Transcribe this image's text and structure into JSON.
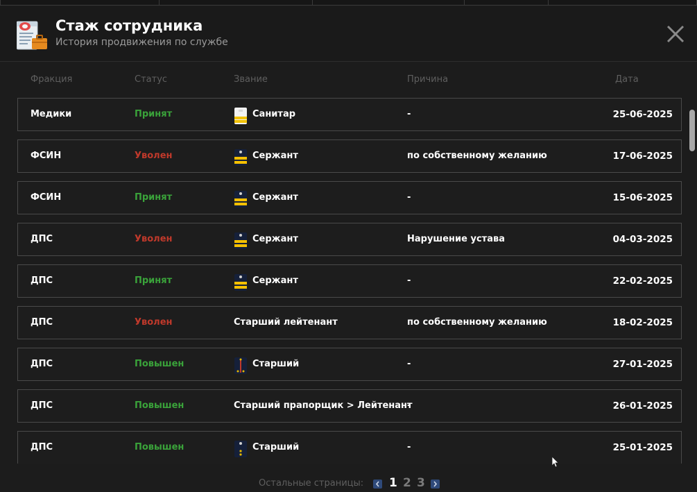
{
  "dialog": {
    "title": "Стаж сотрудника",
    "subtitle": "История продвижения по службе"
  },
  "columns": {
    "faction": "Фракция",
    "status": "Статус",
    "rank": "Звание",
    "reason": "Причина",
    "date": "Дата"
  },
  "rows": [
    {
      "faction": "Медики",
      "status": "Принят",
      "status_type": "green",
      "rank_icon": "medic-rank-icon",
      "rank": "Санитар",
      "reason": "-",
      "date": "25-06-2025"
    },
    {
      "faction": "ФСИН",
      "status": "Уволен",
      "status_type": "red",
      "rank_icon": "sergeant-rank-icon",
      "rank": "Сержант",
      "reason": "по собственному желанию",
      "date": "17-06-2025"
    },
    {
      "faction": "ФСИН",
      "status": "Принят",
      "status_type": "green",
      "rank_icon": "sergeant-rank-icon",
      "rank": "Сержант",
      "reason": "-",
      "date": "15-06-2025"
    },
    {
      "faction": "ДПС",
      "status": "Уволен",
      "status_type": "red",
      "rank_icon": "sergeant-rank-icon",
      "rank": "Сержант",
      "reason": "Нарушение устава",
      "date": "04-03-2025"
    },
    {
      "faction": "ДПС",
      "status": "Принят",
      "status_type": "green",
      "rank_icon": "sergeant-rank-icon",
      "rank": "Сержант",
      "reason": "-",
      "date": "22-02-2025"
    },
    {
      "faction": "ДПС",
      "status": "Уволен",
      "status_type": "red",
      "rank_icon": "",
      "rank": "Старший лейтенант",
      "reason": "по собственному желанию",
      "date": "18-02-2025"
    },
    {
      "faction": "ДПС",
      "status": "Повышен",
      "status_type": "green",
      "rank_icon": "officer-rank-icon",
      "rank": "Старший",
      "reason": "-",
      "date": "27-01-2025"
    },
    {
      "faction": "ДПС",
      "status": "Повышен",
      "status_type": "green",
      "rank_icon": "",
      "rank": "Старший прапорщик > Лейтенант",
      "reason": "-",
      "date": "26-01-2025"
    },
    {
      "faction": "ДПС",
      "status": "Повышен",
      "status_type": "green",
      "rank_icon": "ensign-rank-icon",
      "rank": "Старший",
      "reason": "-",
      "date": "25-01-2025"
    }
  ],
  "pagination": {
    "label": "Остальные страницы:",
    "pages": [
      "1",
      "2",
      "3"
    ],
    "current": "1"
  },
  "colors": {
    "accepted": "#3aa33a",
    "dismissed": "#c0392b",
    "background": "#1c1c1c",
    "pager_arrow": "#2f4a7a"
  }
}
